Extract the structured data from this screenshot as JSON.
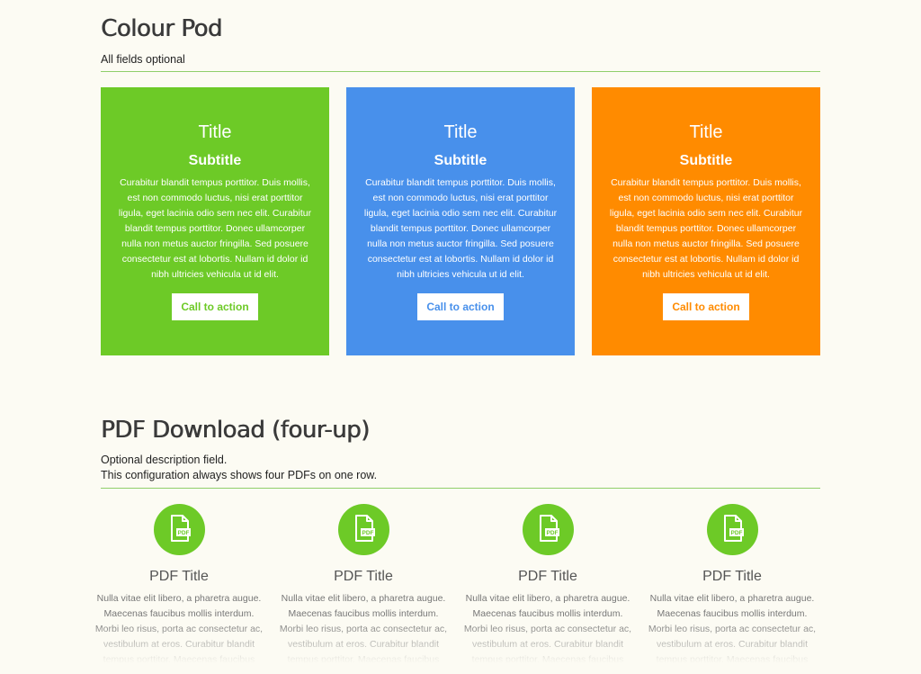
{
  "colour_pod": {
    "heading": "Colour Pod",
    "description": "All fields optional",
    "pods": [
      {
        "color": "#6dca27",
        "title": "Title",
        "subtitle": "Subtitle",
        "body": "Curabitur blandit tempus porttitor. Duis mollis, est non commodo luctus, nisi erat porttitor ligula, eget lacinia odio sem nec elit. Curabitur blandit tempus porttitor. Donec ullamcorper nulla non metus auctor fringilla. Sed posuere consectetur est at lobortis. Nullam id dolor id nibh ultricies vehicula ut id elit.",
        "cta": "Call to action"
      },
      {
        "color": "#4890eb",
        "title": "Title",
        "subtitle": "Subtitle",
        "body": "Curabitur blandit tempus porttitor. Duis mollis, est non commodo luctus, nisi erat porttitor ligula, eget lacinia odio sem nec elit. Curabitur blandit tempus porttitor. Donec ullamcorper nulla non metus auctor fringilla. Sed posuere consectetur est at lobortis. Nullam id dolor id nibh ultricies vehicula ut id elit.",
        "cta": "Call to action"
      },
      {
        "color": "#ff8b00",
        "title": "Title",
        "subtitle": "Subtitle",
        "body": "Curabitur blandit tempus porttitor. Duis mollis, est non commodo luctus, nisi erat porttitor ligula, eget lacinia odio sem nec elit. Curabitur blandit tempus porttitor. Donec ullamcorper nulla non metus auctor fringilla. Sed posuere consectetur est at lobortis. Nullam id dolor id nibh ultricies vehicula ut id elit.",
        "cta": "Call to action"
      }
    ]
  },
  "pdf_download": {
    "heading": "PDF Download (four-up)",
    "description_line1": "Optional description field.",
    "description_line2": "This configuration always shows four PDFs on one row.",
    "icon": "pdf-file-icon",
    "icon_badge": "PDF",
    "items": [
      {
        "title": "PDF Title",
        "body": "Nulla vitae elit libero, a pharetra augue. Maecenas faucibus mollis interdum. Morbi leo risus, porta ac consectetur ac, vestibulum at eros. Curabitur blandit tempus porttitor. Maecenas faucibus"
      },
      {
        "title": "PDF Title",
        "body": "Nulla vitae elit libero, a pharetra augue. Maecenas faucibus mollis interdum. Morbi leo risus, porta ac consectetur ac, vestibulum at eros. Curabitur blandit tempus porttitor. Maecenas faucibus"
      },
      {
        "title": "PDF Title",
        "body": "Nulla vitae elit libero, a pharetra augue. Maecenas faucibus mollis interdum. Morbi leo risus, porta ac consectetur ac, vestibulum at eros. Curabitur blandit tempus porttitor. Maecenas faucibus"
      },
      {
        "title": "PDF Title",
        "body": "Nulla vitae elit libero, a pharetra augue. Maecenas faucibus mollis interdum. Morbi leo risus, porta ac consectetur ac, vestibulum at eros. Curabitur blandit tempus porttitor. Maecenas faucibus"
      }
    ]
  }
}
